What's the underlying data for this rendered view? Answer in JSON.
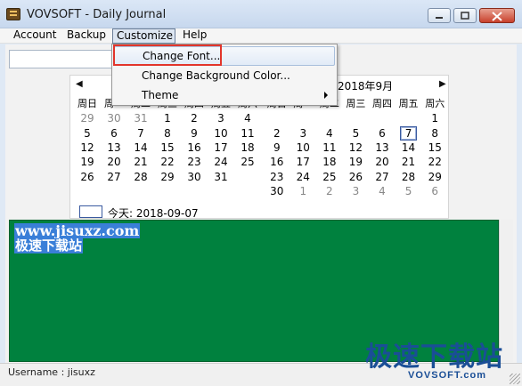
{
  "window": {
    "title": "VOVSOFT - Daily Journal",
    "buttons": [
      "minimize",
      "maximize",
      "close"
    ]
  },
  "menu": {
    "items": [
      {
        "label": "Account"
      },
      {
        "label": "Backup"
      },
      {
        "label": "Customize"
      },
      {
        "label": "Help"
      }
    ]
  },
  "dropdown": {
    "items": [
      {
        "label": "Change Font..."
      },
      {
        "label": "Change Background Color..."
      },
      {
        "label": "Theme",
        "submenu": true
      }
    ]
  },
  "calendar": {
    "left_title": "",
    "right_title": "2018年9月",
    "weekdays": [
      "周日",
      "周一",
      "周二",
      "周三",
      "周四",
      "周五",
      "周六"
    ],
    "left_month": [
      [
        "29",
        "30",
        "31",
        "1",
        "2",
        "3",
        "4"
      ],
      [
        "5",
        "6",
        "7",
        "8",
        "9",
        "10",
        "11"
      ],
      [
        "12",
        "13",
        "14",
        "15",
        "16",
        "17",
        "18"
      ],
      [
        "19",
        "20",
        "21",
        "22",
        "23",
        "24",
        "25"
      ],
      [
        "26",
        "27",
        "28",
        "29",
        "30",
        "31",
        ""
      ]
    ],
    "right_month": [
      [
        "",
        "",
        "",
        "",
        "",
        "",
        "1"
      ],
      [
        "2",
        "3",
        "4",
        "5",
        "6",
        "7",
        "8"
      ],
      [
        "9",
        "10",
        "11",
        "12",
        "13",
        "14",
        "15"
      ],
      [
        "16",
        "17",
        "18",
        "19",
        "20",
        "21",
        "22"
      ],
      [
        "23",
        "24",
        "25",
        "26",
        "27",
        "28",
        "29"
      ],
      [
        "30",
        "1",
        "2",
        "3",
        "4",
        "5",
        "6"
      ]
    ],
    "today_label": "今天: 2018-09-07",
    "selected_day": "7"
  },
  "editor": {
    "lines": [
      "www.jisuxz.com",
      "极速下载站"
    ],
    "background": "#00813e"
  },
  "status": {
    "username_text": "Username : jisuxz"
  },
  "watermark": {
    "cn": "极速下载站",
    "en": "VOVSOFT.com"
  },
  "colors": {
    "highlight_frame": "#e2352b",
    "editor_bg": "#00813e",
    "selection": "#3a7fd8"
  }
}
